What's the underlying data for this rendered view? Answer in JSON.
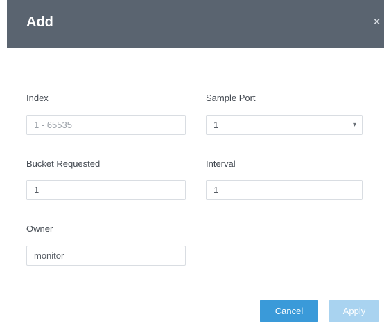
{
  "dialog": {
    "title": "Add",
    "close_icon": "×"
  },
  "form": {
    "index": {
      "label": "Index",
      "placeholder": "1 - 65535"
    },
    "sample_port": {
      "label": "Sample Port",
      "value": "1",
      "arrow": "▾"
    },
    "bucket_requested": {
      "label": "Bucket Requested",
      "value": "1"
    },
    "interval": {
      "label": "Interval",
      "value": "1"
    },
    "owner": {
      "label": "Owner",
      "value": "monitor"
    }
  },
  "buttons": {
    "cancel": "Cancel",
    "apply": "Apply"
  },
  "colors": {
    "header": "#5a6470",
    "primary": "#3a9ad9",
    "primary_disabled": "#a9d3f0"
  }
}
